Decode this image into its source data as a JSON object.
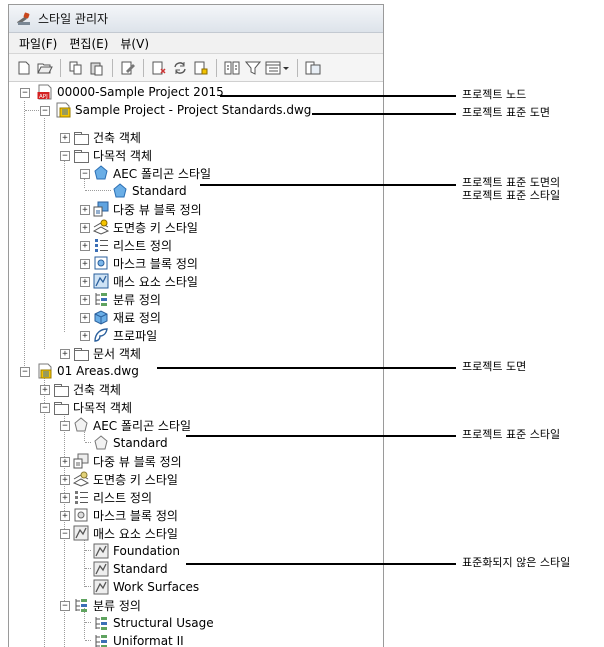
{
  "window": {
    "title": "스타일 관리자"
  },
  "menu": [
    {
      "label": "파일(F)"
    },
    {
      "label": "편집(E)"
    },
    {
      "label": "뷰(V)"
    }
  ],
  "toolbar_icons": [
    "new-drawing-icon",
    "open-drawing-icon",
    "copy-icon",
    "paste-icon",
    "edit-style-icon",
    "purge-icon",
    "synchronize-icon",
    "set-from-standards-icon",
    "sort-icon",
    "filter-icon",
    "view-mode-icon",
    "toggle-view-icon"
  ],
  "tree": {
    "project": "00000-Sample Project 2015",
    "standards_drawing": "Sample Project - Project Standards.dwg",
    "architectural_objects": "건축 객체",
    "multi_purpose_objects": "다목적 객체",
    "aec_polygon_style": "AEC 폴리곤 스타일",
    "standard": "Standard",
    "multi_view_block": "다중 뷰 블록 정의",
    "layer_key_style": "도면층 키 스타일",
    "list_definition": "리스트 정의",
    "mask_block": "마스크 블록 정의",
    "mass_element_style": "매스 요소 스타일",
    "classification": "분류 정의",
    "material": "재료 정의",
    "profile": "프로파일",
    "documentation_objects": "문서 객체",
    "areas_drawing": "01 Areas.dwg",
    "foundation": "Foundation",
    "work_surfaces": "Work Surfaces",
    "structural_usage": "Structural Usage",
    "uniformat": "Uniformat II"
  },
  "callouts": {
    "project_node": "프로젝트 노드",
    "project_standards_drawing": "프로젝트 표준 도면",
    "standards_style_line1": "프로젝트 표준 도면의",
    "standards_style_line2": "프로젝트 표준 스타일",
    "project_drawing": "프로젝트 도면",
    "project_standard_style": "프로젝트 표준 스타일",
    "nonstandard_style": "표준화되지 않은 스타일"
  }
}
